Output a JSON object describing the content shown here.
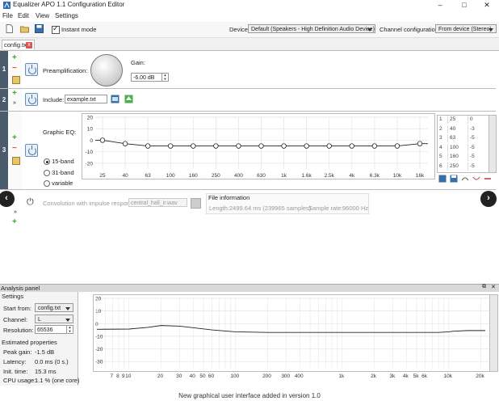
{
  "window": {
    "title": "Equalizer APO 1.1 Configuration Editor",
    "minimize": "–",
    "maximize": "□",
    "close": "✕"
  },
  "menu": [
    "File",
    "Edit",
    "View",
    "Settings"
  ],
  "toolbar": {
    "instant_mode_label": "Instant mode",
    "instant_mode_checked": true,
    "device_label": "Device:",
    "device_value": "Default (Speakers - High Definition Audio Device)",
    "channel_config_label": "Channel configuration:",
    "channel_config_value": "From device (Stereo)"
  },
  "tab": {
    "label": "config.txt",
    "close": "x"
  },
  "rows": {
    "r1": {
      "num": "1",
      "label": "Preamplification:",
      "gain_label": "Gain:",
      "gain_value": "-6.00 dB"
    },
    "r2": {
      "num": "2",
      "label": "Include:",
      "value": "example.txt"
    },
    "r3": {
      "num": "3",
      "label": "Graphic EQ:",
      "radio_15": "15-band",
      "radio_31": "31-band",
      "radio_var": "variable",
      "selected_mode": "15-band"
    },
    "r4": {
      "label": "Convolution with impulse response:",
      "file": "central_hall_ir.wav",
      "info_title": "File information",
      "length_label": "Length:",
      "length_value": "2499.64 ms (239965 samples)",
      "rate_label": "Sample rate:",
      "rate_value": "96000 Hz"
    }
  },
  "nav": {
    "prev": "‹",
    "next": "›"
  },
  "analysis": {
    "title": "Analysis panel",
    "settings_title": "Settings",
    "start_from_label": "Start from:",
    "start_from_value": "config.txt",
    "channel_label": "Channel:",
    "channel_value": "L",
    "resolution_label": "Resolution:",
    "resolution_value": "65536",
    "est_title": "Estimated properties",
    "peak_label": "Peak gain:",
    "peak_value": "-1.5 dB",
    "latency_label": "Latency:",
    "latency_value": "0.0 ms (0 s.)",
    "init_label": "Init. time:",
    "init_value": "15.3 ms",
    "cpu_label": "CPU usage:",
    "cpu_value": "1.1 % (one core)"
  },
  "caption": "New graphical user interface added in version 1.0",
  "chart_data": [
    {
      "type": "line",
      "name": "graphic-eq",
      "ylim": [
        -25,
        20
      ],
      "yticks": [
        "20",
        "10",
        "0",
        "-10",
        "-20"
      ],
      "yvalues": [
        20,
        10,
        0,
        -10,
        -20
      ],
      "x_labels": [
        "25",
        "40",
        "63",
        "100",
        "160",
        "250",
        "400",
        "630",
        "1k",
        "1.6k",
        "2.5k",
        "4k",
        "6.3k",
        "10k",
        "16k"
      ],
      "values": [
        0,
        -3,
        -5,
        -5,
        -5,
        -5,
        -5,
        -5,
        -5,
        -5,
        -5,
        -5,
        -5,
        -5,
        -3
      ],
      "table": {
        "index": [
          "1",
          "2",
          "3",
          "4",
          "5",
          "6"
        ],
        "freq": [
          "25",
          "40",
          "63",
          "100",
          "160",
          "250"
        ],
        "gain": [
          "0",
          "-3",
          "-5",
          "-5",
          "-5",
          "-5"
        ]
      }
    },
    {
      "type": "line",
      "name": "analysis-response",
      "ylim": [
        -35,
        20
      ],
      "yticks": [
        "20",
        "10",
        "0",
        "-10",
        "-20",
        "-30"
      ],
      "yvalues": [
        20,
        10,
        0,
        -10,
        -20,
        -30
      ],
      "x_labels": [
        "7",
        "8",
        "9",
        "10",
        "20",
        "30",
        "40",
        "50",
        "60",
        "100",
        "200",
        "300",
        "400",
        "1k",
        "2k",
        "3k",
        "4k",
        "5k",
        "6k",
        "10k",
        "20k"
      ],
      "x_values": [
        7,
        8,
        9,
        10,
        20,
        30,
        40,
        50,
        60,
        100,
        200,
        300,
        400,
        1000,
        2000,
        3000,
        4000,
        5000,
        6000,
        10000,
        20000
      ],
      "x": [
        5,
        10,
        15,
        20,
        30,
        60,
        100,
        200,
        1000,
        5000,
        8000,
        10000,
        11000,
        15000,
        22000
      ],
      "values": [
        -4.5,
        -4.3,
        -3,
        -1.5,
        -2,
        -5,
        -6.5,
        -7,
        -7,
        -7,
        -7,
        -6.5,
        -6,
        -5.5,
        -5.5
      ]
    }
  ]
}
